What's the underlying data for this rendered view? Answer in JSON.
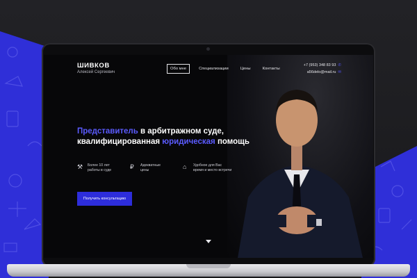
{
  "logo": {
    "name": "ШИВКОВ",
    "subtitle": "Алексей Сергеевич"
  },
  "nav": [
    {
      "label": "Обо мне",
      "active": true
    },
    {
      "label": "Специализации"
    },
    {
      "label": "Цены"
    },
    {
      "label": "Контакты"
    }
  ],
  "contacts": {
    "phone": "+7 (953) 348 83 93",
    "email": "a56delo@mail.ru"
  },
  "headline": {
    "line1_blue": "Представитель",
    "line1_white": "в арбитражном суде,",
    "line2_white": "квалифицированная",
    "line2_blue": "юридическая",
    "line2_tail": "помощь"
  },
  "features": [
    {
      "icon": "tools-icon",
      "text_1": "Более 10 лет",
      "text_2": "работы в суде"
    },
    {
      "icon": "ruble-icon",
      "text_1": "Адекватные",
      "text_2": "цены"
    },
    {
      "icon": "briefcase-icon",
      "text_1": "Удобное для Вас",
      "text_2": "время и место встречи"
    }
  ],
  "cta": {
    "label": "Получить консультацию"
  },
  "colors": {
    "accent": "#2f2fd8",
    "text_blue": "#5b5bff",
    "background": "#070709"
  }
}
